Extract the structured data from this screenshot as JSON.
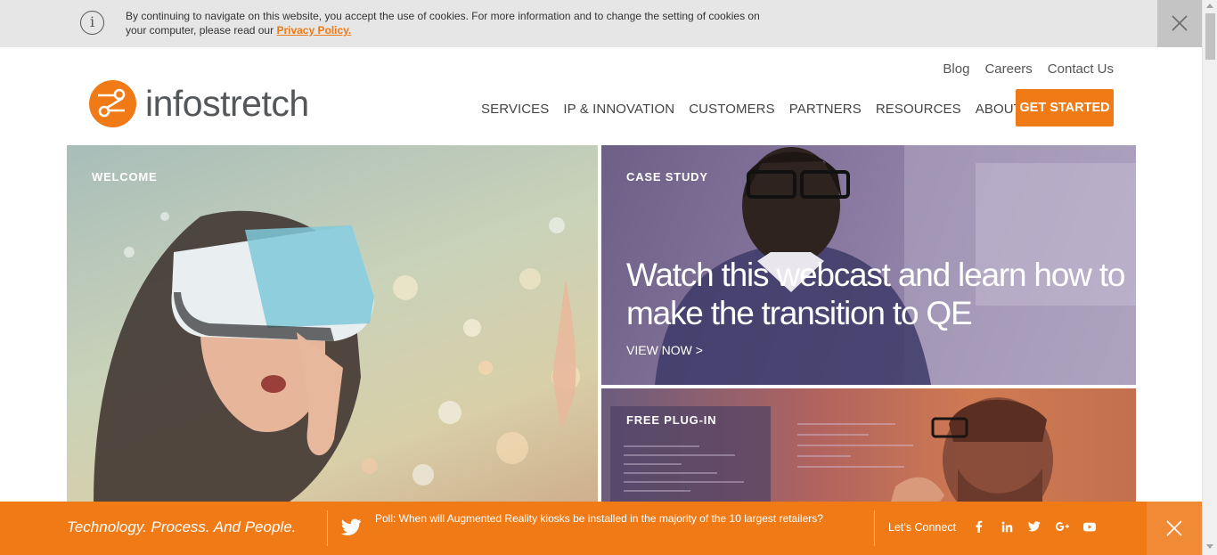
{
  "cookie_bar": {
    "text": "By continuing to navigate on this website, you accept the use of cookies. For more information and to change the setting of cookies on your computer, please read our",
    "link": "Privacy Policy.",
    "info_icon": "info-icon",
    "close_icon": "close-icon"
  },
  "header": {
    "logo_text": "infostretch",
    "utility_nav": [
      "Blog",
      "Careers",
      "Contact Us"
    ],
    "main_nav": [
      "SERVICES",
      "IP & INNOVATION",
      "CUSTOMERS",
      "PARTNERS",
      "RESOURCES",
      "ABOUT"
    ],
    "search_icon": "search-icon",
    "cta": "GET STARTED"
  },
  "tiles": {
    "welcome": {
      "label": "WELCOME"
    },
    "case_study": {
      "label": "CASE STUDY",
      "headline": "Watch this webcast and learn how to make the transition to QE",
      "cta": "VIEW NOW >"
    },
    "plugin": {
      "label": "FREE PLUG-IN"
    }
  },
  "bottom_bar": {
    "tagline": "Technology. Process. And People.",
    "poll": "Poll: When will Augmented Reality kiosks be installed in the majority of the 10 largest retailers?",
    "connect": "Let's Connect",
    "social_icons": [
      "facebook-icon",
      "linkedin-icon",
      "twitter-icon",
      "google-plus-icon",
      "youtube-icon"
    ]
  },
  "colors": {
    "brand_orange": "#ef7a16",
    "text_gray": "#54575a",
    "cookie_bar_bg": "#e6e6e6"
  }
}
